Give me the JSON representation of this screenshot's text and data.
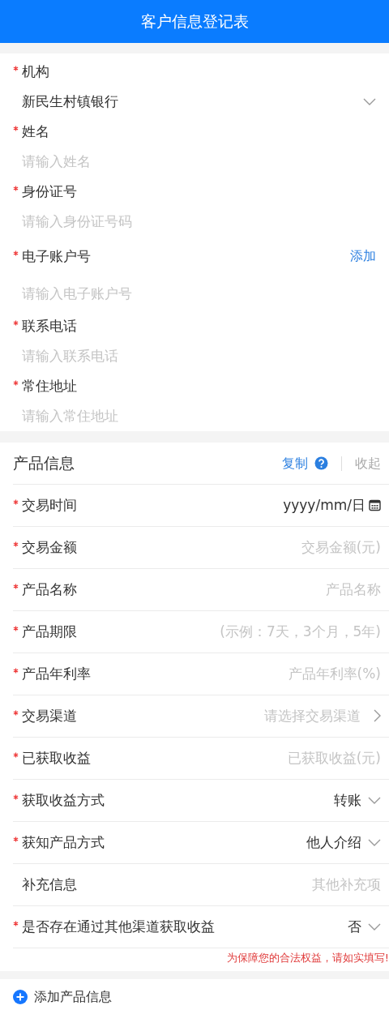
{
  "header": {
    "title": "客户信息登记表"
  },
  "customer_fields": [
    {
      "label": "机构",
      "required": true,
      "kind": "select",
      "value": "新民生村镇银行"
    },
    {
      "label": "姓名",
      "required": true,
      "kind": "input",
      "placeholder": "请输入姓名"
    },
    {
      "label": "身份证号",
      "required": true,
      "kind": "input",
      "placeholder": "请输入身份证号码"
    },
    {
      "label": "电子账户号",
      "required": true,
      "kind": "input",
      "placeholder": "请输入电子账户号",
      "action": "添加"
    },
    {
      "label": "联系电话",
      "required": true,
      "kind": "input",
      "placeholder": "请输入联系电话"
    },
    {
      "label": "常住地址",
      "required": true,
      "kind": "input",
      "placeholder": "请输入常住地址"
    }
  ],
  "product": {
    "title": "产品信息",
    "copy": "复制",
    "collapse": "收起",
    "rows": [
      {
        "label": "交易时间",
        "required": true,
        "kind": "date",
        "value": "yyyy/mm/日"
      },
      {
        "label": "交易金额",
        "required": true,
        "kind": "input",
        "placeholder": "交易金额(元)"
      },
      {
        "label": "产品名称",
        "required": true,
        "kind": "input",
        "placeholder": "产品名称"
      },
      {
        "label": "产品期限",
        "required": true,
        "kind": "input",
        "placeholder": "(示例：7天，3个月，5年)"
      },
      {
        "label": "产品年利率",
        "required": true,
        "kind": "input",
        "placeholder": "产品年利率(%)"
      },
      {
        "label": "交易渠道",
        "required": true,
        "kind": "link",
        "placeholder": "请选择交易渠道"
      },
      {
        "label": "已获取收益",
        "required": true,
        "kind": "input",
        "placeholder": "已获取收益(元)"
      },
      {
        "label": "获取收益方式",
        "required": true,
        "kind": "select",
        "value": "转账"
      },
      {
        "label": "获知产品方式",
        "required": true,
        "kind": "select",
        "value": "他人介绍"
      },
      {
        "label": "补充信息",
        "required": false,
        "kind": "input",
        "placeholder": "其他补充项"
      },
      {
        "label": "是否存在通过其他渠道获取收益",
        "required": true,
        "kind": "select",
        "value": "否"
      }
    ],
    "notice": "为保障您的合法权益，请如实填写!"
  },
  "add_button": "添加产品信息"
}
